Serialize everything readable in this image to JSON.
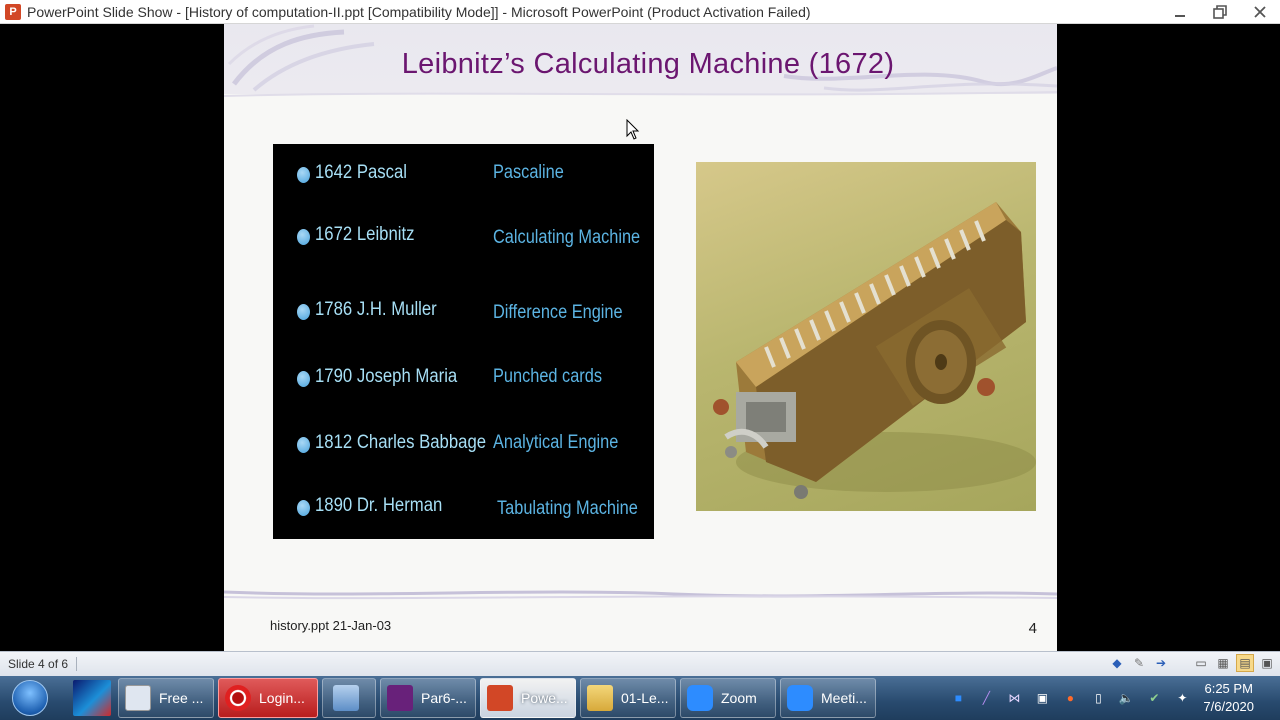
{
  "window": {
    "app_icon_letter": "P",
    "title": "PowerPoint Slide Show - [History of computation-II.ppt [Compatibility Mode]] - Microsoft PowerPoint (Product Activation Failed)"
  },
  "slide": {
    "title": "Leibnitz’s Calculating Machine (1672)",
    "timeline": [
      {
        "left": "1642 Pascal",
        "right": "Pascaline"
      },
      {
        "left": "1672  Leibnitz",
        "right": "Calculating Machine"
      },
      {
        "left": "1786 J.H. Muller",
        "right": "Difference Engine"
      },
      {
        "left": "1790 Joseph Maria",
        "right": "Punched cards"
      },
      {
        "left": "1812 Charles Babbage",
        "right": "Analytical Engine"
      },
      {
        "left": "1890 Dr. Herman",
        "right": "Tabulating Machine"
      }
    ],
    "footer": "history.ppt  21-Jan-03",
    "number": "4"
  },
  "statusbar": {
    "slide_indicator": "Slide 4 of 6"
  },
  "taskbar": {
    "items": [
      {
        "label": "Free ...",
        "icon": "keyboard-icon"
      },
      {
        "label": "Login...",
        "icon": "opera-icon"
      },
      {
        "label": "Par6-...",
        "icon": "visual-studio-icon"
      },
      {
        "label": "Powe...",
        "icon": "powerpoint-icon"
      },
      {
        "label": "01-Le...",
        "icon": "folder-icon"
      },
      {
        "label": "Zoom",
        "icon": "zoom-icon"
      },
      {
        "label": "Meeti...",
        "icon": "zoom-icon"
      }
    ],
    "clock_time": "6:25 PM",
    "clock_date": "7/6/2020"
  },
  "colors": {
    "title": "#6b1670",
    "timeline_left": "#a7dff5",
    "timeline_right": "#5cb4e3"
  }
}
